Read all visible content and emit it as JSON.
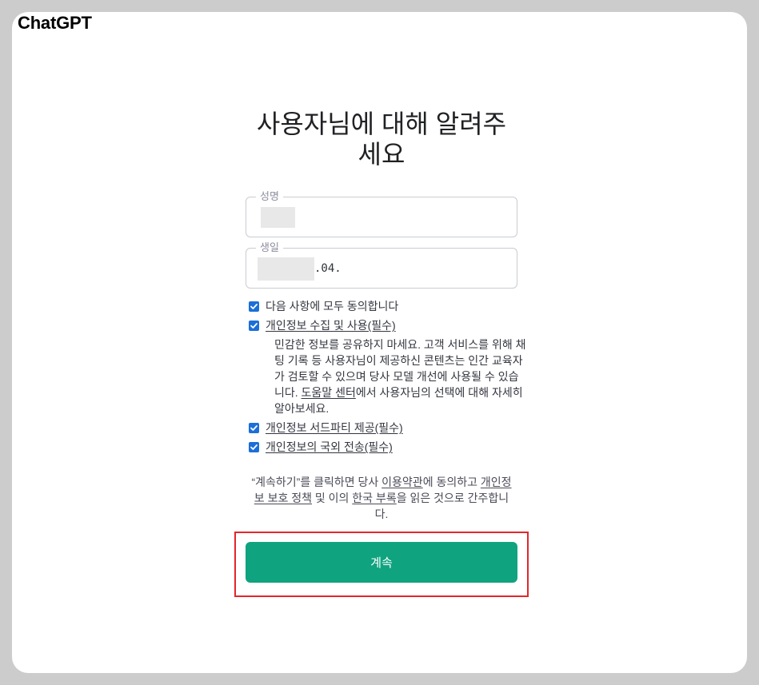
{
  "app": {
    "logo": "ChatGPT"
  },
  "heading": {
    "lines": [
      "사용자님에 대해 알려주",
      "세요"
    ]
  },
  "form": {
    "name_field": {
      "label": "성명"
    },
    "birthday_field": {
      "label": "생일",
      "visible_value": ".04."
    },
    "consents": [
      {
        "label": "다음 사항에 모두 동의합니다",
        "checked": true,
        "is_link": false
      },
      {
        "label": "개인정보 수집 및 사용(필수)",
        "checked": true,
        "is_link": true
      },
      {
        "label": "개인정보 서드파티 제공(필수)",
        "checked": true,
        "is_link": true
      },
      {
        "label": "개인정보의 국외 전송(필수)",
        "checked": true,
        "is_link": true
      }
    ],
    "consent_detail": {
      "text_before": "민감한 정보를 공유하지 마세요. 고객 서비스를 위해 채팅 기록 등 사용자님이 제공하신 콘텐츠는 인간 교육자가 검토할 수 있으며 당사 모델 개선에 사용될 수 있습니다. ",
      "link": "도움말 센터",
      "text_after": "에서 사용자님의 선택에 대해 자세히 알아보세요."
    },
    "terms_notice": {
      "text_1": "“계속하기”를 클릭하면 당사 ",
      "terms_link": "이용약관",
      "text_2": "에 동의하고 ",
      "privacy_link": "개인정보 보호 정책",
      "text_3": " 및 이의 ",
      "korea_link": "한국 부록",
      "text_4": "을 읽은 것으로 간주합니다."
    },
    "continue_button": "계속"
  },
  "icons": {
    "checkbox_checked": "checkmark-icon"
  },
  "colors": {
    "accent": "#10a37f",
    "checkbox": "#1b6fd8",
    "highlight": "#e3262b",
    "background": "#cccccc",
    "card": "#ffffff"
  }
}
